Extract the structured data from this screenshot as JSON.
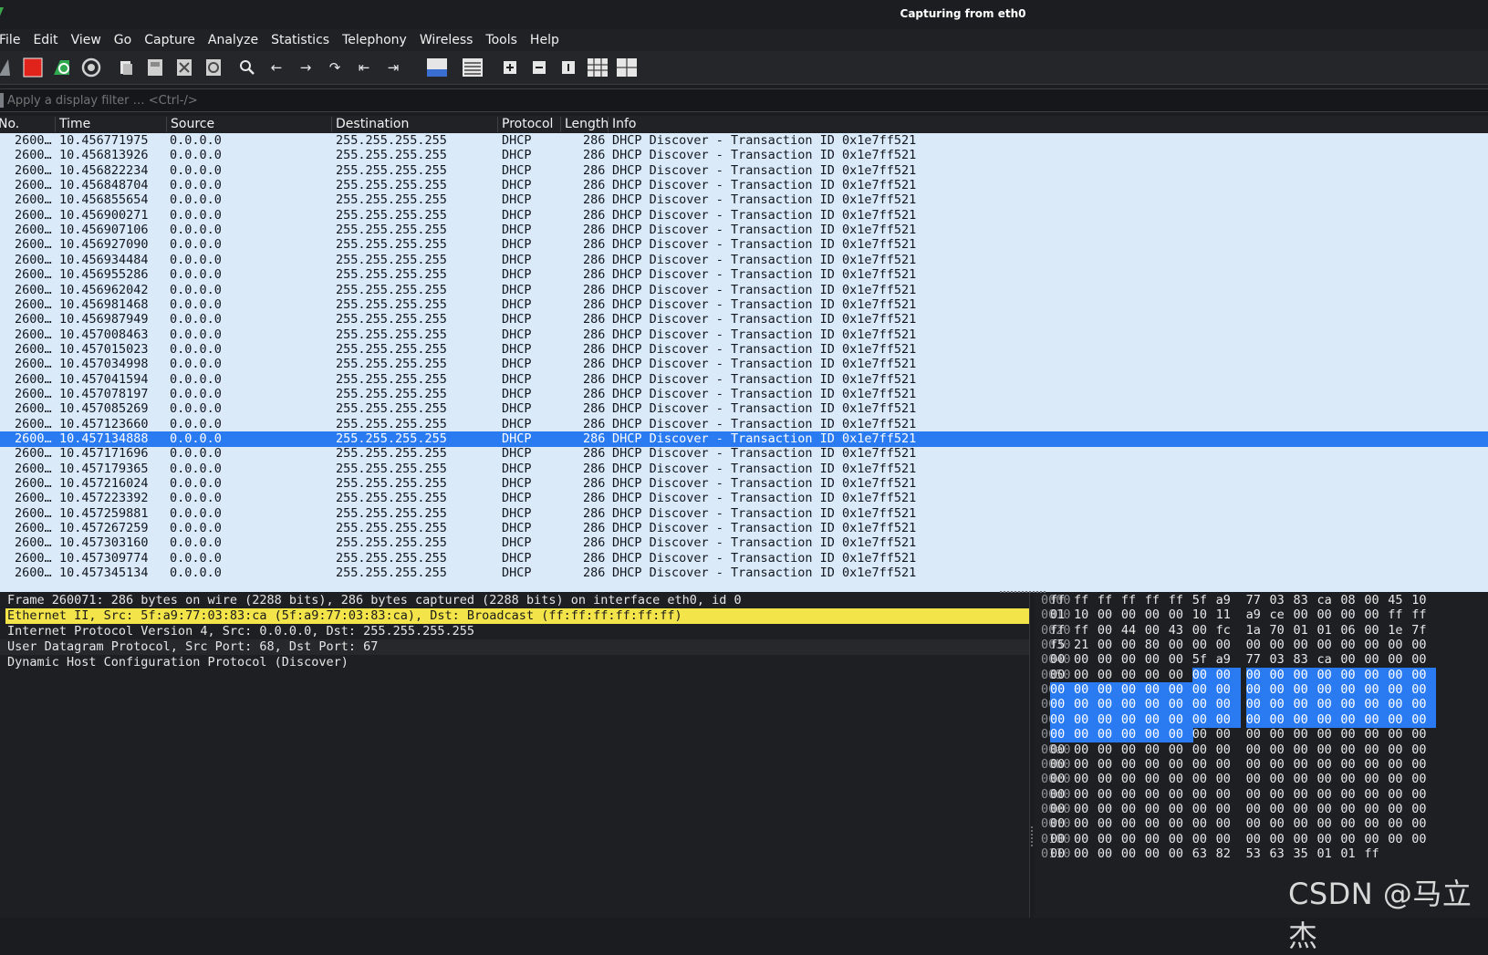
{
  "window": {
    "title": "Capturing from eth0"
  },
  "menu": [
    "File",
    "Edit",
    "View",
    "Go",
    "Capture",
    "Analyze",
    "Statistics",
    "Telephony",
    "Wireless",
    "Tools",
    "Help"
  ],
  "toolbar": {
    "icons": [
      "shark-fin-icon",
      "stop-capture-icon",
      "restart-capture-icon",
      "capture-options-icon",
      "open-file-icon",
      "save-file-icon",
      "close-file-icon",
      "reload-file-icon",
      "find-packet-icon",
      "go-back-icon",
      "go-forward-icon",
      "go-to-packet-icon",
      "first-packet-icon",
      "last-packet-icon",
      "autoscroll-icon",
      "colorize-icon",
      "zoom-in-icon",
      "zoom-out-icon",
      "normal-size-icon",
      "resize-columns-icon"
    ]
  },
  "filter": {
    "placeholder": "Apply a display filter … <Ctrl-/>"
  },
  "packet_list": {
    "columns": [
      "No.",
      "Time",
      "Source",
      "Destination",
      "Protocol",
      "Length",
      "Info"
    ],
    "selected_index": 20,
    "rows": [
      {
        "no": "2600…",
        "time": "10.456771975",
        "src": "0.0.0.0",
        "dst": "255.255.255.255",
        "proto": "DHCP",
        "len": "286",
        "info": "DHCP Discover - Transaction ID 0x1e7ff521"
      },
      {
        "no": "2600…",
        "time": "10.456813926",
        "src": "0.0.0.0",
        "dst": "255.255.255.255",
        "proto": "DHCP",
        "len": "286",
        "info": "DHCP Discover - Transaction ID 0x1e7ff521"
      },
      {
        "no": "2600…",
        "time": "10.456822234",
        "src": "0.0.0.0",
        "dst": "255.255.255.255",
        "proto": "DHCP",
        "len": "286",
        "info": "DHCP Discover - Transaction ID 0x1e7ff521"
      },
      {
        "no": "2600…",
        "time": "10.456848704",
        "src": "0.0.0.0",
        "dst": "255.255.255.255",
        "proto": "DHCP",
        "len": "286",
        "info": "DHCP Discover - Transaction ID 0x1e7ff521"
      },
      {
        "no": "2600…",
        "time": "10.456855654",
        "src": "0.0.0.0",
        "dst": "255.255.255.255",
        "proto": "DHCP",
        "len": "286",
        "info": "DHCP Discover - Transaction ID 0x1e7ff521"
      },
      {
        "no": "2600…",
        "time": "10.456900271",
        "src": "0.0.0.0",
        "dst": "255.255.255.255",
        "proto": "DHCP",
        "len": "286",
        "info": "DHCP Discover - Transaction ID 0x1e7ff521"
      },
      {
        "no": "2600…",
        "time": "10.456907106",
        "src": "0.0.0.0",
        "dst": "255.255.255.255",
        "proto": "DHCP",
        "len": "286",
        "info": "DHCP Discover - Transaction ID 0x1e7ff521"
      },
      {
        "no": "2600…",
        "time": "10.456927090",
        "src": "0.0.0.0",
        "dst": "255.255.255.255",
        "proto": "DHCP",
        "len": "286",
        "info": "DHCP Discover - Transaction ID 0x1e7ff521"
      },
      {
        "no": "2600…",
        "time": "10.456934484",
        "src": "0.0.0.0",
        "dst": "255.255.255.255",
        "proto": "DHCP",
        "len": "286",
        "info": "DHCP Discover - Transaction ID 0x1e7ff521"
      },
      {
        "no": "2600…",
        "time": "10.456955286",
        "src": "0.0.0.0",
        "dst": "255.255.255.255",
        "proto": "DHCP",
        "len": "286",
        "info": "DHCP Discover - Transaction ID 0x1e7ff521"
      },
      {
        "no": "2600…",
        "time": "10.456962042",
        "src": "0.0.0.0",
        "dst": "255.255.255.255",
        "proto": "DHCP",
        "len": "286",
        "info": "DHCP Discover - Transaction ID 0x1e7ff521"
      },
      {
        "no": "2600…",
        "time": "10.456981468",
        "src": "0.0.0.0",
        "dst": "255.255.255.255",
        "proto": "DHCP",
        "len": "286",
        "info": "DHCP Discover - Transaction ID 0x1e7ff521"
      },
      {
        "no": "2600…",
        "time": "10.456987949",
        "src": "0.0.0.0",
        "dst": "255.255.255.255",
        "proto": "DHCP",
        "len": "286",
        "info": "DHCP Discover - Transaction ID 0x1e7ff521"
      },
      {
        "no": "2600…",
        "time": "10.457008463",
        "src": "0.0.0.0",
        "dst": "255.255.255.255",
        "proto": "DHCP",
        "len": "286",
        "info": "DHCP Discover - Transaction ID 0x1e7ff521"
      },
      {
        "no": "2600…",
        "time": "10.457015023",
        "src": "0.0.0.0",
        "dst": "255.255.255.255",
        "proto": "DHCP",
        "len": "286",
        "info": "DHCP Discover - Transaction ID 0x1e7ff521"
      },
      {
        "no": "2600…",
        "time": "10.457034998",
        "src": "0.0.0.0",
        "dst": "255.255.255.255",
        "proto": "DHCP",
        "len": "286",
        "info": "DHCP Discover - Transaction ID 0x1e7ff521"
      },
      {
        "no": "2600…",
        "time": "10.457041594",
        "src": "0.0.0.0",
        "dst": "255.255.255.255",
        "proto": "DHCP",
        "len": "286",
        "info": "DHCP Discover - Transaction ID 0x1e7ff521"
      },
      {
        "no": "2600…",
        "time": "10.457078197",
        "src": "0.0.0.0",
        "dst": "255.255.255.255",
        "proto": "DHCP",
        "len": "286",
        "info": "DHCP Discover - Transaction ID 0x1e7ff521"
      },
      {
        "no": "2600…",
        "time": "10.457085269",
        "src": "0.0.0.0",
        "dst": "255.255.255.255",
        "proto": "DHCP",
        "len": "286",
        "info": "DHCP Discover - Transaction ID 0x1e7ff521"
      },
      {
        "no": "2600…",
        "time": "10.457123660",
        "src": "0.0.0.0",
        "dst": "255.255.255.255",
        "proto": "DHCP",
        "len": "286",
        "info": "DHCP Discover - Transaction ID 0x1e7ff521"
      },
      {
        "no": "2600…",
        "time": "10.457134888",
        "src": "0.0.0.0",
        "dst": "255.255.255.255",
        "proto": "DHCP",
        "len": "286",
        "info": "DHCP Discover - Transaction ID 0x1e7ff521"
      },
      {
        "no": "2600…",
        "time": "10.457171696",
        "src": "0.0.0.0",
        "dst": "255.255.255.255",
        "proto": "DHCP",
        "len": "286",
        "info": "DHCP Discover - Transaction ID 0x1e7ff521"
      },
      {
        "no": "2600…",
        "time": "10.457179365",
        "src": "0.0.0.0",
        "dst": "255.255.255.255",
        "proto": "DHCP",
        "len": "286",
        "info": "DHCP Discover - Transaction ID 0x1e7ff521"
      },
      {
        "no": "2600…",
        "time": "10.457216024",
        "src": "0.0.0.0",
        "dst": "255.255.255.255",
        "proto": "DHCP",
        "len": "286",
        "info": "DHCP Discover - Transaction ID 0x1e7ff521"
      },
      {
        "no": "2600…",
        "time": "10.457223392",
        "src": "0.0.0.0",
        "dst": "255.255.255.255",
        "proto": "DHCP",
        "len": "286",
        "info": "DHCP Discover - Transaction ID 0x1e7ff521"
      },
      {
        "no": "2600…",
        "time": "10.457259881",
        "src": "0.0.0.0",
        "dst": "255.255.255.255",
        "proto": "DHCP",
        "len": "286",
        "info": "DHCP Discover - Transaction ID 0x1e7ff521"
      },
      {
        "no": "2600…",
        "time": "10.457267259",
        "src": "0.0.0.0",
        "dst": "255.255.255.255",
        "proto": "DHCP",
        "len": "286",
        "info": "DHCP Discover - Transaction ID 0x1e7ff521"
      },
      {
        "no": "2600…",
        "time": "10.457303160",
        "src": "0.0.0.0",
        "dst": "255.255.255.255",
        "proto": "DHCP",
        "len": "286",
        "info": "DHCP Discover - Transaction ID 0x1e7ff521"
      },
      {
        "no": "2600…",
        "time": "10.457309774",
        "src": "0.0.0.0",
        "dst": "255.255.255.255",
        "proto": "DHCP",
        "len": "286",
        "info": "DHCP Discover - Transaction ID 0x1e7ff521"
      },
      {
        "no": "2600…",
        "time": "10.457345134",
        "src": "0.0.0.0",
        "dst": "255.255.255.255",
        "proto": "DHCP",
        "len": "286",
        "info": "DHCP Discover - Transaction ID 0x1e7ff521"
      }
    ]
  },
  "details": {
    "highlighted_index": 1,
    "lines": [
      "Frame 260071: 286 bytes on wire (2288 bits), 286 bytes captured (2288 bits) on interface eth0, id 0",
      "Ethernet II, Src: 5f:a9:77:03:83:ca (5f:a9:77:03:83:ca), Dst: Broadcast (ff:ff:ff:ff:ff:ff)",
      "Internet Protocol Version 4, Src: 0.0.0.0, Dst: 255.255.255.255",
      "User Datagram Protocol, Src Port: 68, Dst Port: 67",
      "Dynamic Host Configuration Protocol (Discover)"
    ]
  },
  "bytes": {
    "rows": [
      {
        "offset": "0000",
        "hex": [
          "ff",
          "ff",
          "ff",
          "ff",
          "ff",
          "ff",
          "5f",
          "a9",
          "77",
          "03",
          "83",
          "ca",
          "08",
          "00",
          "45",
          "10"
        ]
      },
      {
        "offset": "0010",
        "hex": [
          "01",
          "10",
          "00",
          "00",
          "00",
          "00",
          "10",
          "11",
          "a9",
          "ce",
          "00",
          "00",
          "00",
          "00",
          "ff",
          "ff"
        ]
      },
      {
        "offset": "0020",
        "hex": [
          "ff",
          "ff",
          "00",
          "44",
          "00",
          "43",
          "00",
          "fc",
          "1a",
          "70",
          "01",
          "01",
          "06",
          "00",
          "1e",
          "7f"
        ]
      },
      {
        "offset": "0030",
        "hex": [
          "f5",
          "21",
          "00",
          "00",
          "80",
          "00",
          "00",
          "00",
          "00",
          "00",
          "00",
          "00",
          "00",
          "00",
          "00",
          "00"
        ]
      },
      {
        "offset": "0040",
        "hex": [
          "00",
          "00",
          "00",
          "00",
          "00",
          "00",
          "5f",
          "a9",
          "77",
          "03",
          "83",
          "ca",
          "00",
          "00",
          "00",
          "00"
        ]
      },
      {
        "offset": "0050",
        "hex": [
          "00",
          "00",
          "00",
          "00",
          "00",
          "00",
          "00",
          "00",
          "00",
          "00",
          "00",
          "00",
          "00",
          "00",
          "00",
          "00"
        ]
      },
      {
        "offset": "0060",
        "hex": [
          "00",
          "00",
          "00",
          "00",
          "00",
          "00",
          "00",
          "00",
          "00",
          "00",
          "00",
          "00",
          "00",
          "00",
          "00",
          "00"
        ]
      },
      {
        "offset": "0070",
        "hex": [
          "00",
          "00",
          "00",
          "00",
          "00",
          "00",
          "00",
          "00",
          "00",
          "00",
          "00",
          "00",
          "00",
          "00",
          "00",
          "00"
        ]
      },
      {
        "offset": "0080",
        "hex": [
          "00",
          "00",
          "00",
          "00",
          "00",
          "00",
          "00",
          "00",
          "00",
          "00",
          "00",
          "00",
          "00",
          "00",
          "00",
          "00"
        ]
      },
      {
        "offset": "0090",
        "hex": [
          "00",
          "00",
          "00",
          "00",
          "00",
          "00",
          "00",
          "00",
          "00",
          "00",
          "00",
          "00",
          "00",
          "00",
          "00",
          "00"
        ]
      },
      {
        "offset": "00a0",
        "hex": [
          "00",
          "00",
          "00",
          "00",
          "00",
          "00",
          "00",
          "00",
          "00",
          "00",
          "00",
          "00",
          "00",
          "00",
          "00",
          "00"
        ]
      },
      {
        "offset": "00b0",
        "hex": [
          "00",
          "00",
          "00",
          "00",
          "00",
          "00",
          "00",
          "00",
          "00",
          "00",
          "00",
          "00",
          "00",
          "00",
          "00",
          "00"
        ]
      },
      {
        "offset": "00c0",
        "hex": [
          "00",
          "00",
          "00",
          "00",
          "00",
          "00",
          "00",
          "00",
          "00",
          "00",
          "00",
          "00",
          "00",
          "00",
          "00",
          "00"
        ]
      },
      {
        "offset": "00d0",
        "hex": [
          "00",
          "00",
          "00",
          "00",
          "00",
          "00",
          "00",
          "00",
          "00",
          "00",
          "00",
          "00",
          "00",
          "00",
          "00",
          "00"
        ]
      },
      {
        "offset": "00e0",
        "hex": [
          "00",
          "00",
          "00",
          "00",
          "00",
          "00",
          "00",
          "00",
          "00",
          "00",
          "00",
          "00",
          "00",
          "00",
          "00",
          "00"
        ]
      },
      {
        "offset": "00f0",
        "hex": [
          "00",
          "00",
          "00",
          "00",
          "00",
          "00",
          "00",
          "00",
          "00",
          "00",
          "00",
          "00",
          "00",
          "00",
          "00",
          "00"
        ]
      },
      {
        "offset": "0100",
        "hex": [
          "00",
          "00",
          "00",
          "00",
          "00",
          "00",
          "00",
          "00",
          "00",
          "00",
          "00",
          "00",
          "00",
          "00",
          "00",
          "00"
        ]
      },
      {
        "offset": "0110",
        "hex": [
          "00",
          "00",
          "00",
          "00",
          "00",
          "00",
          "63",
          "82",
          "53",
          "63",
          "35",
          "01",
          "01",
          "ff"
        ]
      }
    ],
    "selected_range": {
      "start": 86,
      "end": 149
    }
  },
  "watermark": "CSDN @马立杰",
  "colors": {
    "selected_row": "#2a7bf2",
    "list_bg": "#daeaf8",
    "highlight": "#f3e44a",
    "stop_button": "#e0231b"
  }
}
